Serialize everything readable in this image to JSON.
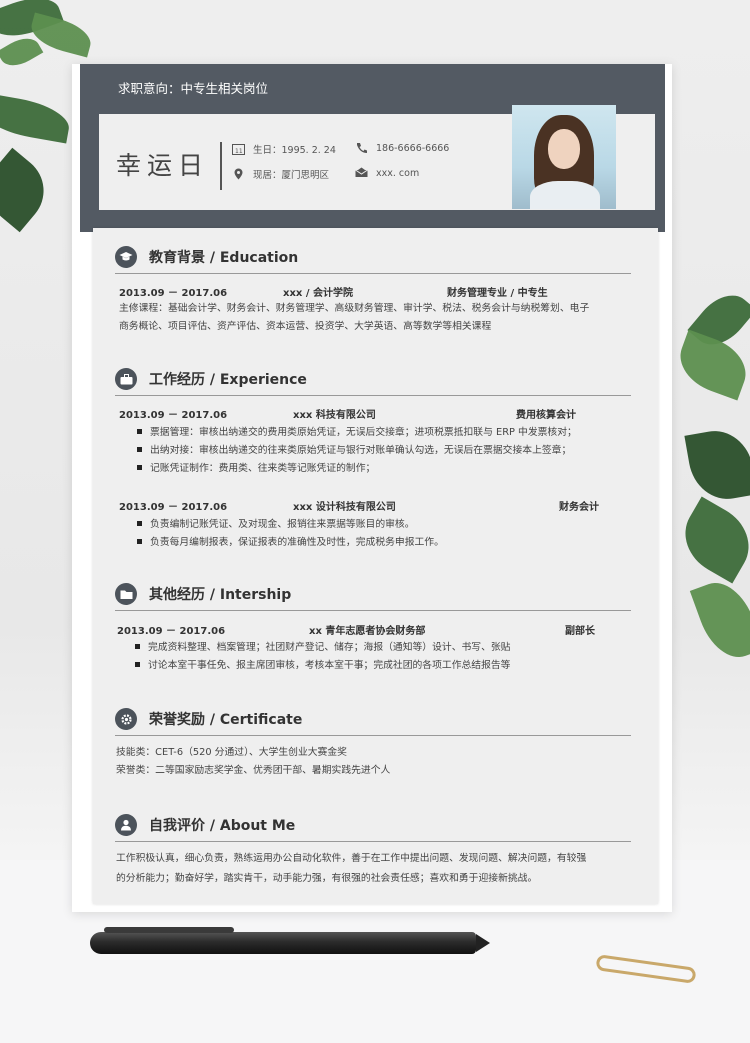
{
  "header": {
    "intent": "求职意向：中专生相关岗位",
    "name": "幸运日",
    "birth": "生日：1995. 2. 24",
    "phone": "186-6666-6666",
    "address": "现居：厦门思明区",
    "email": "xxx. com"
  },
  "sections": {
    "education": {
      "title": "教育背景 / Education",
      "date": "2013.09 － 2017.06",
      "school": "xxx / 会计学院",
      "major": "财务管理专业 / 中专生",
      "courses_line1": "主修课程：基础会计学、财务会计、财务管理学、高级财务管理、审计学、税法、税务会计与纳税筹划、电子",
      "courses_line2": "商务概论、项目评估、资产评估、资本运营、投资学、大学英语、高等数学等相关课程"
    },
    "experience": {
      "title": "工作经历 / Experience",
      "job1": {
        "date": "2013.09 － 2017.06",
        "company": "xxx 科技有限公司",
        "role": "费用核算会计",
        "items": [
          "票据管理：审核出纳递交的费用类原始凭证，无误后交接章；进项税票抵扣联与 ERP 中发票核对；",
          "出纳对接：审核出纳递交的往来类原始凭证与银行对账单确认勾选，无误后在票据交接本上签章；",
          "记账凭证制作：费用类、往来类等记账凭证的制作；"
        ]
      },
      "job2": {
        "date": "2013.09 － 2017.06",
        "company": "xxx 设计科技有限公司",
        "role": "财务会计",
        "items": [
          "负责编制记账凭证、及对现金、报销往来票据等账目的审核。",
          "负责每月编制报表，保证报表的准确性及时性，完成税务申报工作。"
        ]
      }
    },
    "other": {
      "title": "其他经历 / Intership",
      "date": "2013.09 － 2017.06",
      "org": "xx 青年志愿者协会财务部",
      "role": "副部长",
      "items": [
        "完成资料整理、档案管理；社团财产登记、储存；海报（通知等）设计、书写、张贴",
        "讨论本室干事任免、报主席团审核，考核本室干事；完成社团的各项工作总结报告等"
      ]
    },
    "certificate": {
      "title": "荣誉奖励 / Certificate",
      "line1": "技能类：CET-6（520 分通过）、大学生创业大赛金奖",
      "line2": "荣誉类：二等国家励志奖学金、优秀团干部、暑期实践先进个人"
    },
    "about": {
      "title": "自我评价 / About Me",
      "line1": "工作积极认真，细心负责，熟练运用办公自动化软件，善于在工作中提出问题、发现问题、解决问题，有较强",
      "line2": "的分析能力；勤奋好学，踏实肯干，动手能力强，有很强的社会责任感；喜欢和勇于迎接新挑战。"
    }
  },
  "icons": {
    "education": "graduation-cap-icon",
    "experience": "briefcase-icon",
    "other": "folder-icon",
    "certificate": "gear-icon",
    "about": "person-icon"
  },
  "colors": {
    "header_bar": "#535a63",
    "panel": "#efefef",
    "icon_circle": "#4c535b"
  }
}
